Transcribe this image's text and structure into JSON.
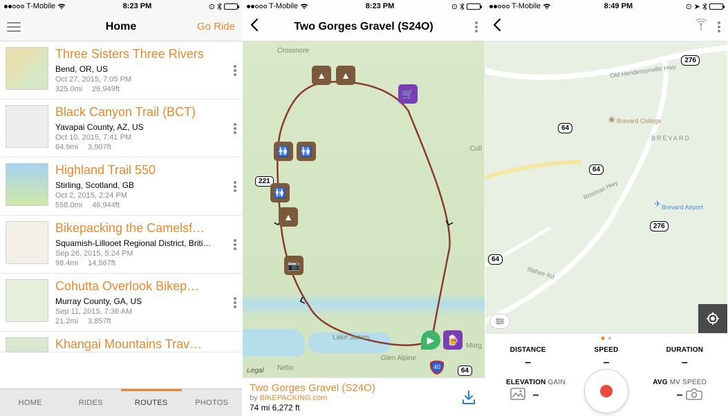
{
  "phone1": {
    "status": {
      "carrier": "T-Mobile",
      "time": "8:23 PM"
    },
    "nav": {
      "title": "Home",
      "right": "Go Ride"
    },
    "routes": [
      {
        "title": "Three Sisters Three Rivers",
        "loc": "Bend, OR, US",
        "date": "Oct 27, 2015, 7:05 PM",
        "dist": "325.0mi",
        "elev": "26,949ft"
      },
      {
        "title": "Black Canyon Trail (BCT)",
        "loc": "Yavapai County, AZ, US",
        "date": "Oct 10, 2015, 7:41 PM",
        "dist": "64.9mi",
        "elev": "3,907ft"
      },
      {
        "title": "Highland Trail 550",
        "loc": "Stirling, Scotland, GB",
        "date": "Oct 2, 2015, 2:24 PM",
        "dist": "558.0mi",
        "elev": "46,944ft"
      },
      {
        "title": "Bikepacking the Camelsf…",
        "loc": "Squamish-Lillooet Regional District, Briti…",
        "date": "Sep 26, 2015, 5:24 PM",
        "dist": "98.4mi",
        "elev": "14,567ft"
      },
      {
        "title": "Cohutta Overlook Bikep…",
        "loc": "Murray County, GA, US",
        "date": "Sep 11, 2015, 7:36 AM",
        "dist": "21.2mi",
        "elev": "3,857ft"
      },
      {
        "title": "Khangai Mountains Trav…"
      }
    ],
    "tabs": {
      "home": "HOME",
      "rides": "RIDES",
      "routes": "ROUTES",
      "photos": "PHOTOS"
    }
  },
  "phone2": {
    "status": {
      "carrier": "T-Mobile",
      "time": "8:23 PM"
    },
    "nav": {
      "title": "Two Gorges Gravel (S24O)"
    },
    "map": {
      "towns": {
        "crossnore": "Crossnore",
        "nebo": "Nebo",
        "glen": "Glen Alpine",
        "lake": "Lake James",
        "coll": "Coll",
        "morg": "Morg"
      },
      "shields": {
        "s221": "221",
        "s64": "64",
        "i40": "40"
      },
      "legal": "Legal"
    },
    "footer": {
      "title": "Two Gorges Gravel (S24O)",
      "by_word": "by ",
      "by_author": "BIKEPACKING.com",
      "stats": "74 mi 6,272 ft"
    }
  },
  "phone3": {
    "status": {
      "carrier": "T-Mobile",
      "time": "8:49 PM"
    },
    "map": {
      "shields": {
        "s276a": "276",
        "s64a": "64",
        "s64b": "64",
        "s64c": "64",
        "s276b": "276"
      },
      "labels": {
        "brevard": "BREVARD",
        "college": "Brevard College",
        "airport": "Brevard Airport",
        "rosman": "Rosman Hwy",
        "old": "Old Hendersonville Hwy",
        "illahee": "Illahee Rd"
      }
    },
    "panel": {
      "distance_lbl": "DISTANCE",
      "speed_lbl": "SPEED",
      "duration_lbl": "DURATION",
      "elevation_lbl": "ELEVATION",
      "gain_lbl": " GAIN",
      "avg_lbl": "AVG",
      "mv_lbl": " MV SPEED",
      "dash": "–"
    }
  }
}
